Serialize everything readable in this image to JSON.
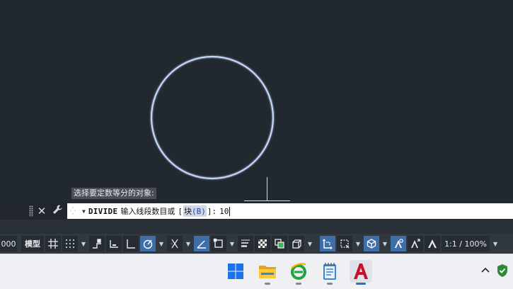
{
  "canvas": {
    "history_prompt": "选择要定数等分的对象:"
  },
  "command_line": {
    "close_icon": "close-icon",
    "settings_icon": "wrench-icon",
    "command_name": "DIVIDE",
    "prompt_text": "输入线段数目或",
    "option_open": "[",
    "option_label": "块",
    "option_key": "(B)",
    "option_close": "]:",
    "input_value": "10"
  },
  "status_bar": {
    "coord_readout": "000",
    "model_label": "模型",
    "scale_label": "1:1 / 100%",
    "icons": [
      "grid-icon",
      "snap-icon",
      "infer-icon",
      "dynamic-ucs-icon",
      "ortho-icon",
      "polar-icon",
      "isodraft-icon",
      "object-snap-track-icon",
      "object-snap-icon",
      "lineweight-icon",
      "transparency-icon",
      "selection-cycling-icon",
      "3d-osnap-icon",
      "dynamic-input-icon",
      "selection-filter-icon",
      "gizmo-icon",
      "annotation-visibility-icon",
      "auto-scale-icon",
      "annotation-scale-icon"
    ]
  },
  "taskbar": {
    "apps": [
      "windows-start",
      "file-explorer",
      "internet-explorer",
      "notepad",
      "autocad"
    ],
    "tray": [
      "show-hidden-icons",
      "security-shield"
    ]
  },
  "colors": {
    "canvas_bg": "#212830",
    "circle_stroke": "#c8d8ff",
    "active_toggle": "#3f6fa8",
    "autocad_red": "#c8102e"
  }
}
